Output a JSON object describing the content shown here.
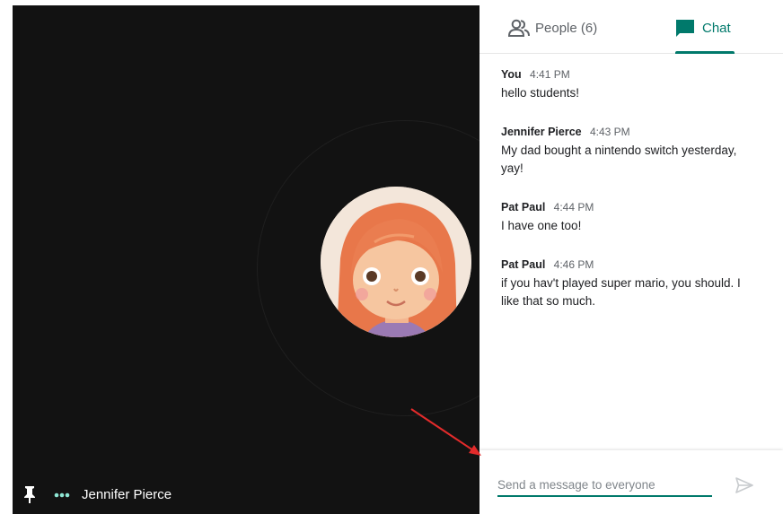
{
  "video": {
    "participant_name": "Jennifer Pierce",
    "pin_icon": "pin-icon",
    "more_icon": "more-dots-icon"
  },
  "tabs": {
    "people_label": "People (6)",
    "chat_label": "Chat",
    "active": "chat"
  },
  "messages": [
    {
      "sender": "You",
      "time": "4:41 PM",
      "lines": [
        "hello students!"
      ]
    },
    {
      "sender": "Jennifer Pierce",
      "time": "4:43 PM",
      "lines": [
        "My dad bought a nintendo switch yesterday,",
        "yay!"
      ]
    },
    {
      "sender": "Pat Paul",
      "time": "4:44 PM",
      "lines": [
        "I have one too!"
      ]
    },
    {
      "sender": "Pat Paul",
      "time": "4:46 PM",
      "lines": [
        "if you hav't played super mario, you should. I",
        "like that so much."
      ]
    }
  ],
  "compose": {
    "placeholder": "Send a message to everyone",
    "value": ""
  },
  "colors": {
    "accent": "#00796b",
    "video_bg": "#121212",
    "dots": "#8ee6d4",
    "annotation_arrow": "#e32b2b"
  }
}
